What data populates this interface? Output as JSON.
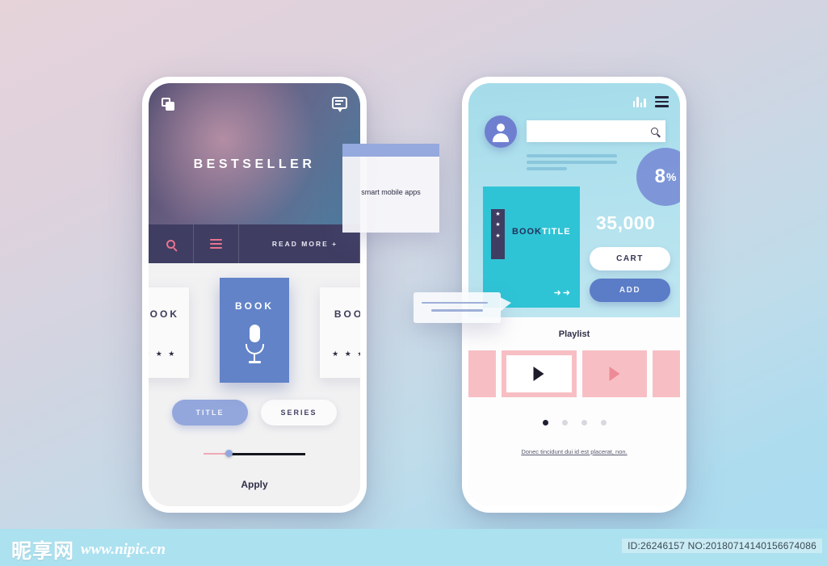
{
  "background": {
    "from": "#e6d3da",
    "to": "#a9dcf0"
  },
  "phone1": {
    "hero": {
      "title": "BESTSELLER",
      "copy_icon": "copy-icon",
      "chat_icon": "chat-bubble-icon"
    },
    "navbar": {
      "search_icon": "search-icon",
      "menu_icon": "hamburger-menu-icon",
      "read_more": "READ MORE +"
    },
    "carousel": {
      "left": {
        "label": "BOOK",
        "stars": "★ ★ ★"
      },
      "center": {
        "label": "BOOK",
        "icon": "microphone-icon"
      },
      "right": {
        "label": "BOO",
        "stars": "★ ★ ★"
      }
    },
    "filters": [
      {
        "label": "TITLE",
        "active": true
      },
      {
        "label": "SERIES",
        "active": false
      }
    ],
    "slider": {
      "value_pct": 25
    },
    "apply_label": "Apply"
  },
  "phone2": {
    "header": {
      "chart_icon": "bar-chart-icon",
      "menu_icon": "hamburger-menu-icon",
      "avatar_icon": "user-avatar-icon",
      "search_placeholder": "",
      "search_value": "",
      "search_icon": "search-icon"
    },
    "badge": {
      "value": "8",
      "unit": "%"
    },
    "book": {
      "ribbon_stars": "★★★",
      "title_dark": "BOOK",
      "title_light": "TITLE",
      "arrows": "➜➜"
    },
    "price": "35,000",
    "buttons": [
      {
        "label": "CART",
        "style": "white"
      },
      {
        "label": "ADD",
        "style": "blue"
      }
    ],
    "playlist": {
      "title": "Playlist",
      "items": [
        {
          "type": "edge",
          "play": false
        },
        {
          "type": "white",
          "play": true,
          "color": "dark"
        },
        {
          "type": "mid",
          "play": true,
          "color": "pink"
        },
        {
          "type": "edge",
          "play": false
        }
      ]
    },
    "dots": {
      "count": 4,
      "active_index": 0
    },
    "footer_link": "Donec tincidunt dui id est placerat, non."
  },
  "floating": {
    "smart_card": {
      "text": "smart mobile apps"
    },
    "bubble": {
      "lines": 2
    }
  },
  "watermark": {
    "logo_cn": "昵享网",
    "url": "www.nipic.cn",
    "id_text": "ID:26246157 NO:20180714140156674086"
  }
}
